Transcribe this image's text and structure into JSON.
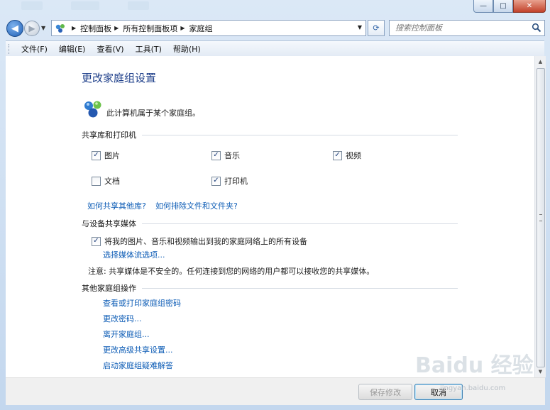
{
  "window": {
    "caption": {
      "minimize": "—",
      "maximize": "□",
      "close": "✕"
    }
  },
  "nav": {
    "back_glyph": "◀",
    "forward_glyph": "▶",
    "history_glyph": "▼",
    "breadcrumbs": [
      "控制面板",
      "所有控制面板项",
      "家庭组"
    ],
    "crumb_sep": "▶",
    "address_dropdown": "▼",
    "refresh_glyph": "⟳",
    "search_placeholder": "搜索控制面板"
  },
  "menu": {
    "items": [
      "文件(F)",
      "编辑(E)",
      "查看(V)",
      "工具(T)",
      "帮助(H)"
    ]
  },
  "content": {
    "title": "更改家庭组设置",
    "status": "此计算机属于某个家庭组。",
    "share_section": {
      "heading": "共享库和打印机",
      "items": [
        {
          "label": "图片",
          "checked": true
        },
        {
          "label": "音乐",
          "checked": true
        },
        {
          "label": "视频",
          "checked": true
        },
        {
          "label": "文档",
          "checked": false
        },
        {
          "label": "打印机",
          "checked": true
        }
      ],
      "links": [
        "如何共享其他库?",
        "如何排除文件和文件夹?"
      ]
    },
    "media_section": {
      "heading": "与设备共享媒体",
      "stream_label": "将我的图片、音乐和视频输出到我的家庭网络上的所有设备",
      "stream_checked": true,
      "stream_link": "选择媒体流选项...",
      "note": "注意: 共享媒体是不安全的。任何连接到您的网络的用户都可以接收您的共享媒体。"
    },
    "other_section": {
      "heading": "其他家庭组操作",
      "links": [
        "查看或打印家庭组密码",
        "更改密码...",
        "离开家庭组...",
        "更改高级共享设置...",
        "启动家庭组疑难解答"
      ]
    }
  },
  "buttons": {
    "save": "保存修改",
    "cancel": "取消"
  },
  "scrollbar": {
    "up": "▲",
    "down": "▼"
  },
  "watermark": {
    "brand": "Baidu 经验",
    "sub": "jingyan.baidu.com"
  },
  "colors": {
    "link": "#0b5bb5",
    "title": "#1e3f8a"
  }
}
